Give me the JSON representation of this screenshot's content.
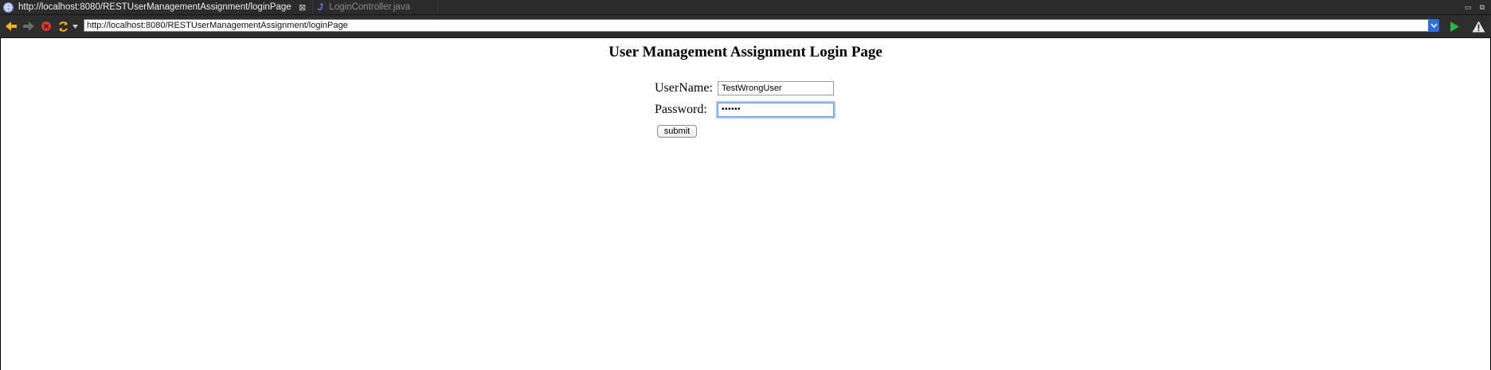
{
  "tabs": [
    {
      "label": "http://localhost:8080/RESTUserManagementAssignment/loginPage",
      "active": true
    },
    {
      "label": "LoginController.java",
      "active": false
    }
  ],
  "toolbar": {
    "address_url": "http://localhost:8080/RESTUserManagementAssignment/loginPage"
  },
  "page": {
    "title": "User Management Assignment Login Page",
    "username_label": "UserName:",
    "username_value": "TestWrongUser",
    "password_label": "Password:",
    "password_mask": "••••••",
    "submit_label": "submit"
  },
  "colors": {
    "chrome_dark": "#2b2b2b",
    "back_arrow": "#f2b21c",
    "stop": "#d23b3b",
    "refresh": "#f2b21c",
    "go": "#29b24a",
    "focus_ring": "#a9c8f0"
  },
  "icons": [
    "globe-icon",
    "close-icon",
    "java-file-icon",
    "back-arrow-icon",
    "forward-arrow-icon",
    "stop-icon",
    "refresh-icon",
    "dropdown-icon",
    "go-icon",
    "warning-icon",
    "minimize-icon",
    "restore-icon"
  ]
}
